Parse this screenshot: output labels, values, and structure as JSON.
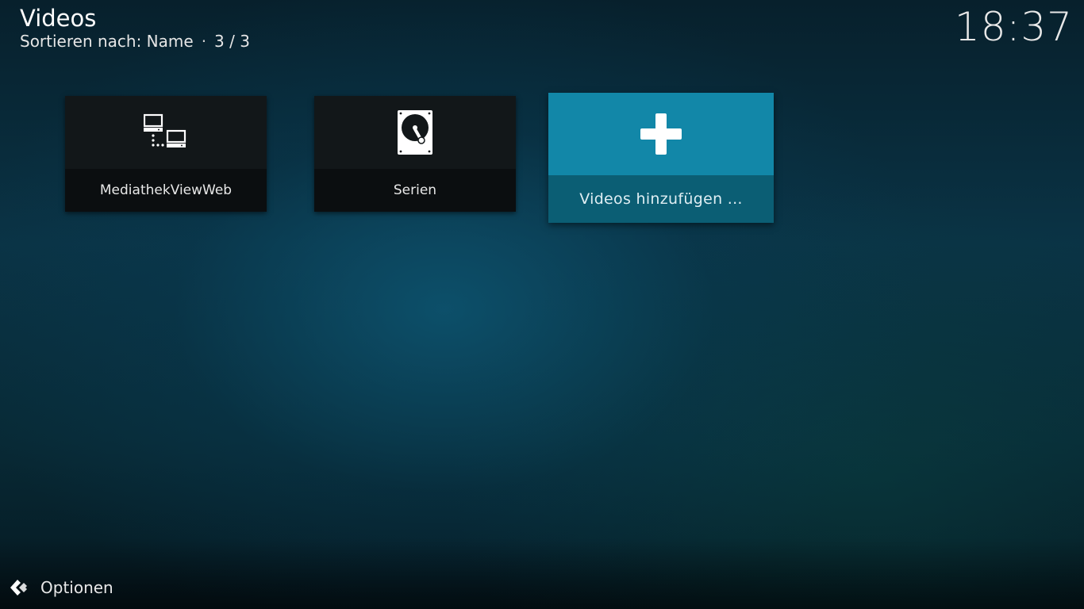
{
  "header": {
    "title": "Videos",
    "sort_label": "Sortieren nach: Name",
    "separator": "·",
    "count": "3 / 3"
  },
  "clock": "18:37",
  "tiles": [
    {
      "label": "MediathekViewWeb",
      "icon": "network-icon"
    },
    {
      "label": "Serien",
      "icon": "harddisk-icon"
    },
    {
      "label": "Videos hinzufügen ...",
      "icon": "plus-icon",
      "focused": true
    }
  ],
  "footer": {
    "options_label": "Optionen",
    "options_icon": "options-icon"
  },
  "colors": {
    "focus_accent": "#12829f",
    "focus_label_bg": "#0b5e74",
    "tile_bg": "#101416"
  }
}
